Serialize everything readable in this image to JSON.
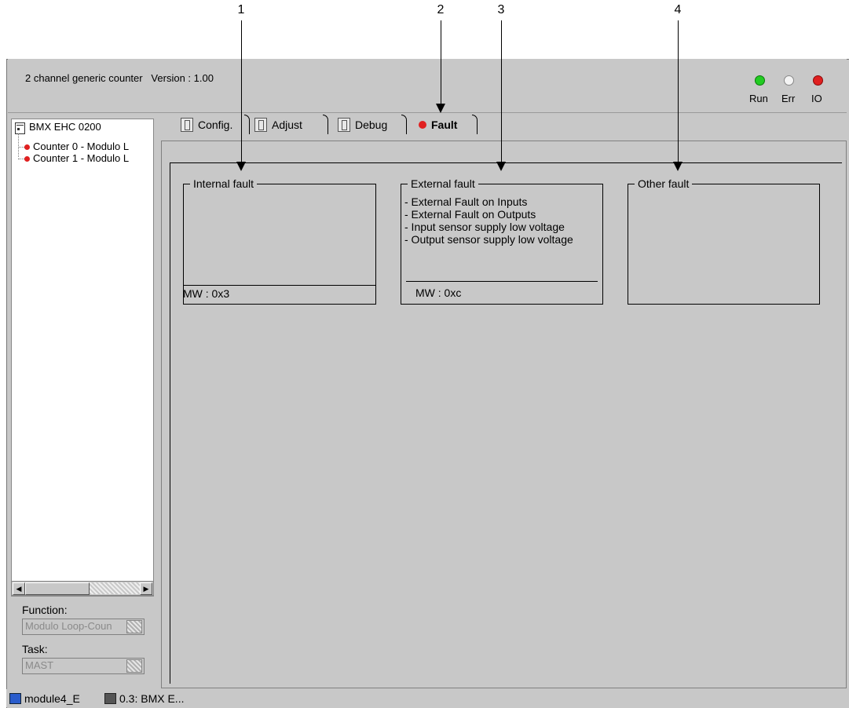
{
  "callouts": [
    "1",
    "2",
    "3",
    "4"
  ],
  "header": {
    "title": "2 channel generic counter   Version : 1.00"
  },
  "status_leds": [
    {
      "label": "Run",
      "color": "#22cc22"
    },
    {
      "label": "Err",
      "color": "#ffffff"
    },
    {
      "label": "IO",
      "color": "#e02020"
    }
  ],
  "tree": {
    "root": "BMX EHC 0200",
    "items": [
      "Counter 0 - Modulo L",
      "Counter 1 - Modulo L"
    ]
  },
  "function": {
    "label": "Function:",
    "value": "Modulo Loop-Coun"
  },
  "task": {
    "label": "Task:",
    "value": "MAST"
  },
  "tabs": [
    {
      "label": "Config.",
      "icon": "config-icon"
    },
    {
      "label": "Adjust",
      "icon": "adjust-icon"
    },
    {
      "label": "Debug",
      "icon": "debug-icon"
    },
    {
      "label": "Fault",
      "icon": "fault-icon",
      "active": true
    }
  ],
  "faults": {
    "internal": {
      "title": "Internal fault",
      "mw": "MW : 0x3"
    },
    "external": {
      "title": "External fault",
      "items": [
        "- External Fault on Inputs",
        "- External Fault on Outputs",
        "- Input sensor supply low voltage",
        "- Output sensor supply low voltage"
      ],
      "mw": "MW : 0xc"
    },
    "other": {
      "title": "Other fault"
    }
  },
  "statusbar": {
    "item1": "module4_E",
    "item2": "0.3: BMX E..."
  }
}
